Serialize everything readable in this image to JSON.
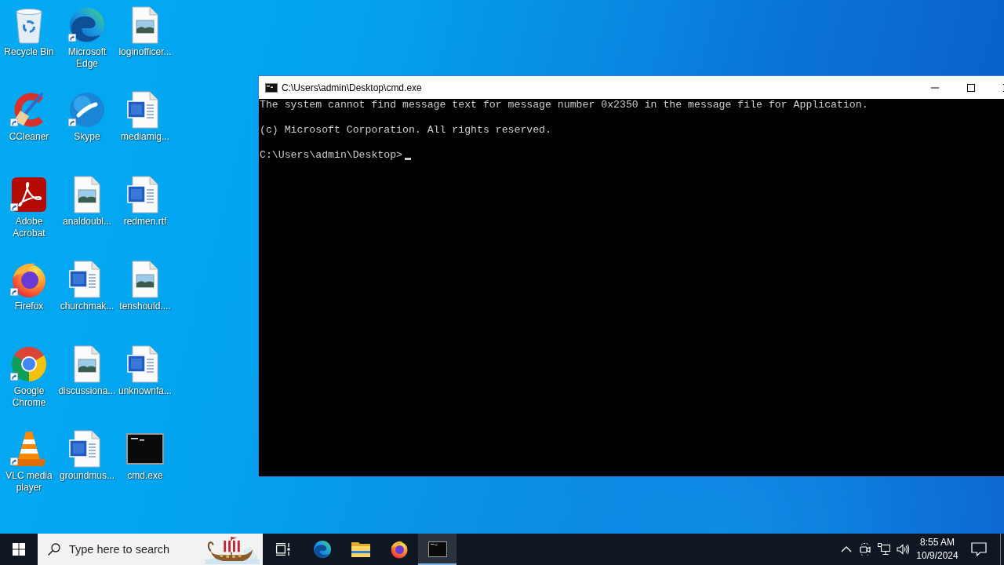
{
  "desktop": {
    "icons": [
      {
        "label": "Recycle Bin",
        "kind": "recycle-bin",
        "shortcut": false
      },
      {
        "label": "Microsoft Edge",
        "kind": "edge",
        "shortcut": true
      },
      {
        "label": "loginofficer...",
        "kind": "image-file",
        "shortcut": false
      },
      {
        "label": "CCleaner",
        "kind": "ccleaner",
        "shortcut": true
      },
      {
        "label": "Skype",
        "kind": "skype",
        "shortcut": true
      },
      {
        "label": "mediamig...",
        "kind": "word-file",
        "shortcut": false
      },
      {
        "label": "Adobe Acrobat",
        "kind": "acrobat",
        "shortcut": true
      },
      {
        "label": "analdoubl...",
        "kind": "image-file",
        "shortcut": false
      },
      {
        "label": "redmen.rtf",
        "kind": "word-file",
        "shortcut": false
      },
      {
        "label": "Firefox",
        "kind": "firefox",
        "shortcut": true
      },
      {
        "label": "churchmak...",
        "kind": "word-file",
        "shortcut": false
      },
      {
        "label": "tenshould....",
        "kind": "image-file",
        "shortcut": false
      },
      {
        "label": "Google Chrome",
        "kind": "chrome",
        "shortcut": true
      },
      {
        "label": "discussiona...",
        "kind": "image-file",
        "shortcut": false
      },
      {
        "label": "unknownfa...",
        "kind": "word-file",
        "shortcut": false
      },
      {
        "label": "VLC media player",
        "kind": "vlc",
        "shortcut": true
      },
      {
        "label": "groundmus...",
        "kind": "word-file",
        "shortcut": false
      },
      {
        "label": "cmd.exe",
        "kind": "console",
        "shortcut": false
      }
    ]
  },
  "console_window": {
    "title": "C:\\Users\\admin\\Desktop\\cmd.exe",
    "lines": [
      "The system cannot find message text for message number 0x2350 in the message file for Application.",
      "(c) Microsoft Corporation. All rights reserved."
    ],
    "prompt": "C:\\Users\\admin\\Desktop>"
  },
  "taskbar": {
    "search": {
      "placeholder": "Type here to search"
    },
    "buttons": [
      {
        "kind": "task-view",
        "active": false
      },
      {
        "kind": "edge",
        "active": false
      },
      {
        "kind": "file-explorer",
        "active": false
      },
      {
        "kind": "firefox",
        "active": false
      },
      {
        "kind": "console",
        "active": true
      }
    ],
    "clock": {
      "time": "8:55 AM",
      "date": "10/9/2024"
    }
  }
}
